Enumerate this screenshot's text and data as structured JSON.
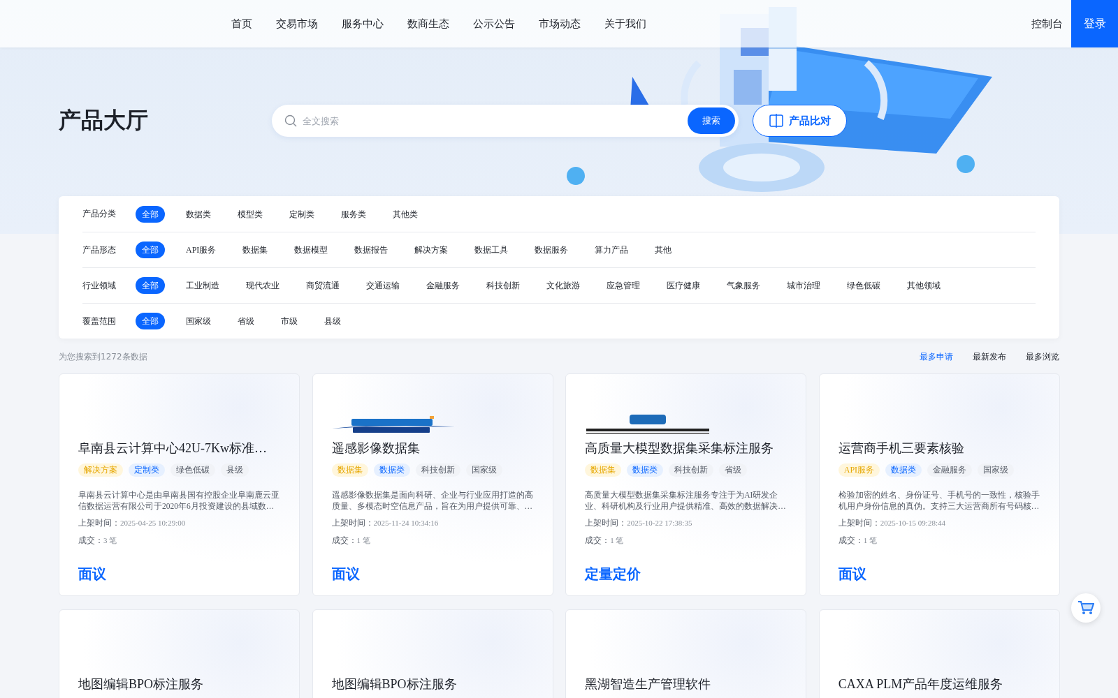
{
  "nav": {
    "items": [
      {
        "label": "首页",
        "selected": false
      },
      {
        "label": "交易市场",
        "selected": false
      },
      {
        "label": "服务中心",
        "selected": false
      },
      {
        "label": "数商生态",
        "selected": false
      },
      {
        "label": "公示公告",
        "selected": false
      },
      {
        "label": "市场动态",
        "selected": false
      },
      {
        "label": "关于我们",
        "selected": false
      }
    ],
    "console": "控制台",
    "login": "登录"
  },
  "title": "产品大厅",
  "search": {
    "placeholder": "全文搜索",
    "button": "搜索"
  },
  "compare_button": "产品比对",
  "filters": [
    {
      "label": "产品分类",
      "options": [
        {
          "text": "全部",
          "selected": true
        },
        {
          "text": "数据类",
          "selected": false
        },
        {
          "text": "模型类",
          "selected": false
        },
        {
          "text": "定制类",
          "selected": false
        },
        {
          "text": "服务类",
          "selected": false
        },
        {
          "text": "其他类",
          "selected": false
        }
      ]
    },
    {
      "label": "产品形态",
      "options": [
        {
          "text": "全部",
          "selected": true
        },
        {
          "text": "API服务",
          "selected": false
        },
        {
          "text": "数据集",
          "selected": false
        },
        {
          "text": "数据模型",
          "selected": false
        },
        {
          "text": "数据报告",
          "selected": false
        },
        {
          "text": "解决方案",
          "selected": false
        },
        {
          "text": "数据工具",
          "selected": false
        },
        {
          "text": "数据服务",
          "selected": false
        },
        {
          "text": "算力产品",
          "selected": false
        },
        {
          "text": "其他",
          "selected": false
        }
      ]
    },
    {
      "label": "行业领域",
      "options": [
        {
          "text": "全部",
          "selected": true
        },
        {
          "text": "工业制造",
          "selected": false
        },
        {
          "text": "现代农业",
          "selected": false
        },
        {
          "text": "商贸流通",
          "selected": false
        },
        {
          "text": "交通运输",
          "selected": false
        },
        {
          "text": "金融服务",
          "selected": false
        },
        {
          "text": "科技创新",
          "selected": false
        },
        {
          "text": "文化旅游",
          "selected": false
        },
        {
          "text": "应急管理",
          "selected": false
        },
        {
          "text": "医疗健康",
          "selected": false
        },
        {
          "text": "气象服务",
          "selected": false
        },
        {
          "text": "城市治理",
          "selected": false
        },
        {
          "text": "绿色低碳",
          "selected": false
        },
        {
          "text": "其他领域",
          "selected": false
        }
      ]
    },
    {
      "label": "覆盖范围",
      "options": [
        {
          "text": "全部",
          "selected": true
        },
        {
          "text": "国家级",
          "selected": false
        },
        {
          "text": "省级",
          "selected": false
        },
        {
          "text": "市级",
          "selected": false
        },
        {
          "text": "县级",
          "selected": false
        }
      ]
    }
  ],
  "result_count": "为您搜索到1272条数据",
  "sort": [
    {
      "text": "最多申请",
      "selected": true
    },
    {
      "text": "最新发布",
      "selected": false
    },
    {
      "text": "最多浏览",
      "selected": false
    }
  ],
  "cards": [
    {
      "title": "阜南县云计算中心42U-7Kw标准…",
      "tags": [
        {
          "text": "解决方案",
          "kind": "form"
        },
        {
          "text": "定制类",
          "kind": "category"
        },
        {
          "text": "绿色低碳",
          "kind": "plain"
        },
        {
          "text": "县级",
          "kind": "plain"
        }
      ],
      "description": "阜南县云计算中心是由阜南县国有控股企业阜南鹿云亚信数据运营有限公司于2020年6月投资建设的县域数…",
      "listed_label": "上架时间：",
      "listed_time": "2025-04-25 10:29:00",
      "deals_label": "成交：",
      "deals": "3 笔",
      "price": "面议"
    },
    {
      "logo": {
        "kind": "swoosh"
      },
      "title": "遥感影像数据集",
      "tags": [
        {
          "text": "数据集",
          "kind": "form"
        },
        {
          "text": "数据类",
          "kind": "category"
        },
        {
          "text": "科技创新",
          "kind": "plain"
        },
        {
          "text": "国家级",
          "kind": "plain"
        }
      ],
      "description": "遥感影像数据集是面向科研、企业与行业应用打造的高质量、多模态时空信息产品，旨在为用户提供可靠、…",
      "listed_label": "上架时间：",
      "listed_time": "2025-11-24 10:34:16",
      "deals_label": "成交：",
      "deals": "1 笔",
      "price": "面议"
    },
    {
      "logo": {
        "kind": "badge"
      },
      "title": "高质量大模型数据集采集标注服务",
      "tags": [
        {
          "text": "数据集",
          "kind": "form"
        },
        {
          "text": "数据类",
          "kind": "category"
        },
        {
          "text": "科技创新",
          "kind": "plain"
        },
        {
          "text": "省级",
          "kind": "plain"
        }
      ],
      "description": "高质量大模型数据集采集标注服务专注于为AI研发企业、科研机构及行业用户提供精准、高效的数据解决…",
      "listed_label": "上架时间：",
      "listed_time": "2025-10-22 17:38:35",
      "deals_label": "成交：",
      "deals": "1 笔",
      "price": "定量定价"
    },
    {
      "title": "运营商手机三要素核验",
      "tags": [
        {
          "text": "API服务",
          "kind": "form"
        },
        {
          "text": "数据类",
          "kind": "category"
        },
        {
          "text": "金融服务",
          "kind": "plain"
        },
        {
          "text": "国家级",
          "kind": "plain"
        }
      ],
      "description": "检验加密的姓名、身份证号、手机号的一致性，核验手机用户身份信息的真伪。支持三大运营商所有号码核…",
      "listed_label": "上架时间：",
      "listed_time": "2025-10-15 09:28:44",
      "deals_label": "成交：",
      "deals": "1 笔",
      "price": "面议"
    },
    {
      "title": "地图编辑BPO标注服务"
    },
    {
      "title": "地图编辑BPO标注服务"
    },
    {
      "title": "黑湖智造生产管理软件"
    },
    {
      "title": "CAXA PLM产品年度运维服务"
    }
  ]
}
